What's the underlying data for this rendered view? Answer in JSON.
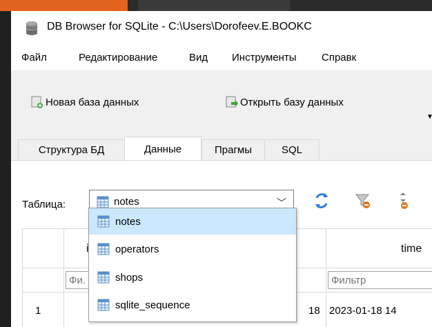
{
  "window": {
    "title": "DB Browser for SQLite - C:\\Users\\Dorofeev.E.BOOKC"
  },
  "menu": {
    "file": "Файл",
    "edit": "Редактирование",
    "view": "Вид",
    "tools": "Инструменты",
    "help": "Справк"
  },
  "toolbar": {
    "new_db": "Новая база данных",
    "open_db": "Открыть базу данных"
  },
  "tabs": {
    "structure": "Структура БД",
    "data": "Данные",
    "pragmas": "Прагмы",
    "sql": "SQL"
  },
  "browse": {
    "table_label": "Таблица:",
    "selected_table": "notes"
  },
  "grid": {
    "headers": {
      "id": "id",
      "time": "time"
    },
    "filter_placeholder": {
      "id": "Фи.",
      "time": "Фильтр"
    },
    "rows": [
      {
        "num": "1",
        "partial": "18",
        "time": "2023-01-18 14"
      }
    ]
  },
  "dropdown": {
    "items": [
      "notes",
      "operators",
      "shops",
      "sqlite_sequence"
    ],
    "selected": "notes"
  },
  "colors": {
    "selection": "#cce8ff",
    "accent": "#0078d7"
  }
}
